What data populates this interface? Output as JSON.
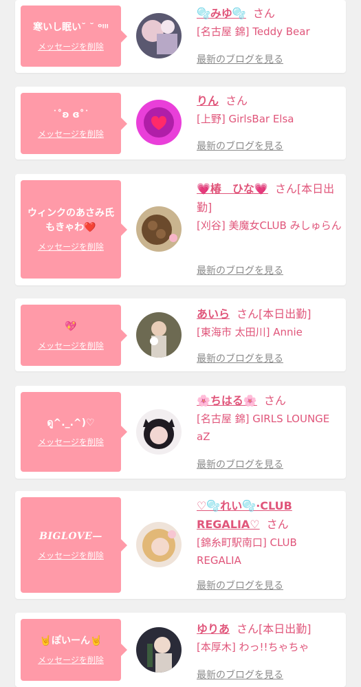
{
  "cards": [
    {
      "message": "寒いし眠い˘ ˘ ᵒᵎᵎᵎ",
      "delete_label": "メッセージを削除",
      "name": "🫧みゆ🫧",
      "honorific": "さん",
      "shop": "[名古屋 錦] Teddy Bear",
      "blog_link": "最新のブログを見る"
    },
    {
      "message": "˙˚ʚ ɞ˚˙",
      "delete_label": "メッセージを削除",
      "name": "りん",
      "honorific": "さん",
      "shop": "[上野] GirlsBar Elsa",
      "blog_link": "最新のブログを見る"
    },
    {
      "message": "ウィンクのあさみ氏もきゃわ❤️",
      "delete_label": "メッセージを削除",
      "name": "💗椿　ひな💗",
      "honorific": "さん[本日出勤]",
      "shop": "[刈谷] 美魔女CLUB みしゅらん",
      "blog_link": "最新のブログを見る"
    },
    {
      "message": "💖",
      "delete_label": "メッセージを削除",
      "name": "あいら",
      "honorific": "さん[本日出勤]",
      "shop": "[東海市 太田川] Annie",
      "blog_link": "最新のブログを見る"
    },
    {
      "message": "ดู^._.^)♡",
      "delete_label": "メッセージを削除",
      "name": "🌸ちはる🌸",
      "honorific": "さん",
      "shop": "[名古屋 錦] GIRLS LOUNGE aZ",
      "blog_link": "最新のブログを見る"
    },
    {
      "message": "BIGLOVE—",
      "delete_label": "メッセージを削除",
      "name": "♡🫧れい🫧·CLUB REGALIA♡",
      "honorific": "さん",
      "shop": "[錦糸町駅南口] CLUB REGALIA",
      "blog_link": "最新のブログを見る"
    },
    {
      "message": "🤘ぽいーん🤘",
      "delete_label": "メッセージを削除",
      "name": "ゆりあ",
      "honorific": "さん[本日出勤]",
      "shop": "[本厚木] わっ!!ちゃちゃ",
      "blog_link": "最新のブログを見る"
    }
  ]
}
